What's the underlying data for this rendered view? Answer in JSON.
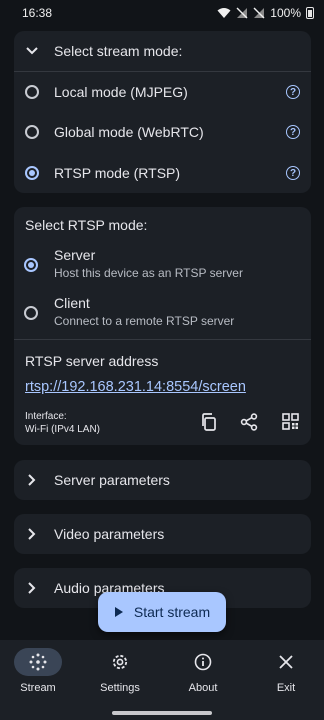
{
  "status_bar": {
    "time": "16:38",
    "battery_percent": "100%"
  },
  "stream_mode": {
    "title": "Select stream mode:",
    "options": [
      {
        "label": "Local mode (MJPEG)",
        "selected": false
      },
      {
        "label": "Global mode (WebRTC)",
        "selected": false
      },
      {
        "label": "RTSP mode (RTSP)",
        "selected": true
      }
    ],
    "help_glyph": "?"
  },
  "rtsp_mode": {
    "title": "Select RTSP mode:",
    "options": [
      {
        "label": "Server",
        "description": "Host this device as an RTSP server",
        "selected": true
      },
      {
        "label": "Client",
        "description": "Connect to a remote RTSP server",
        "selected": false
      }
    ],
    "address_title": "RTSP server address",
    "address": "rtsp://192.168.231.14:8554/screen",
    "interface_label": "Interface:",
    "interface_value": "Wi-Fi (IPv4 LAN)"
  },
  "sections": {
    "server_parameters": "Server parameters",
    "video_parameters": "Video parameters",
    "audio_parameters": "Audio parameters"
  },
  "fab": {
    "label": "Start stream"
  },
  "nav": {
    "stream": "Stream",
    "settings": "Settings",
    "about": "About",
    "exit": "Exit"
  },
  "colors": {
    "accent": "#a9c7ff",
    "background": "#111418",
    "surface": "#1c2026"
  }
}
